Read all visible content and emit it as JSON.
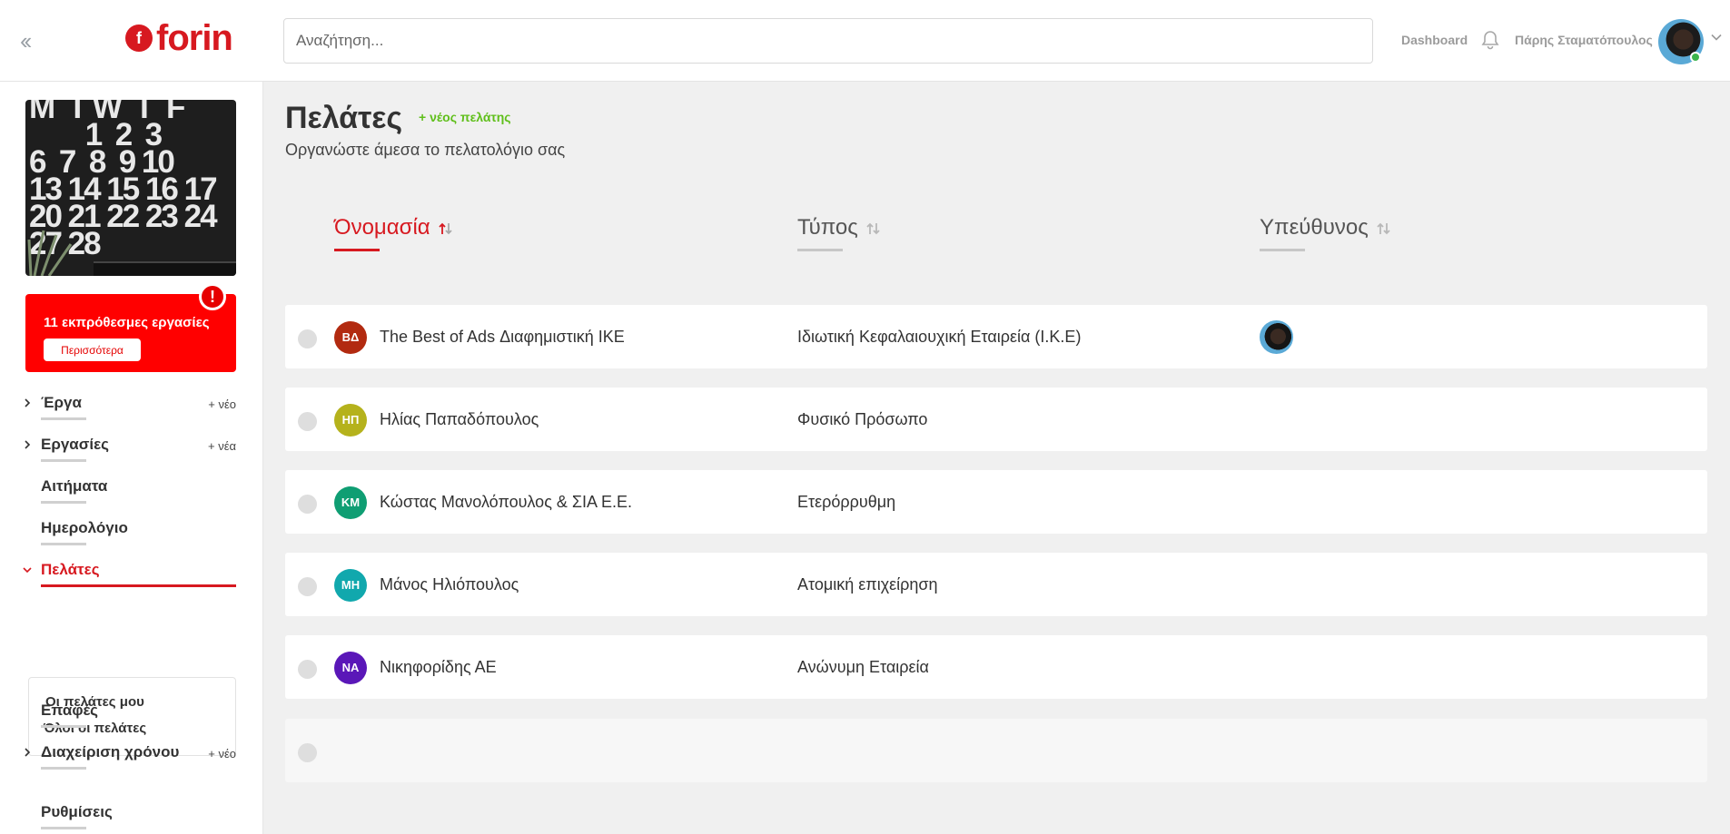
{
  "header": {
    "collapse_icon": "double-chevron-left-icon",
    "logo_text": "forin",
    "logo_mark": "f",
    "search_placeholder": "Αναζήτηση...",
    "dashboard_label": "Dashboard",
    "bell_icon": "bell-icon",
    "user_name": "Πάρης Σταματόπουλος"
  },
  "sidebar": {
    "calendar_text": "M  T W  T  F\n        1  2  3\n6  7  8  9 10\n13 14 15 16 17\n20 21 22 23 24\n27 28",
    "alert": {
      "text": "11 εκπρόθεσμες εργασίες",
      "button": "Περισσότερα",
      "badge": "!"
    },
    "items": [
      {
        "label": "Έργα",
        "add": "+ νέο",
        "chevron": "right"
      },
      {
        "label": "Εργασίες",
        "add": "+ νέα",
        "chevron": "right"
      },
      {
        "label": "Αιτήματα"
      },
      {
        "label": "Ημερολόγιο"
      },
      {
        "label": "Πελάτες",
        "chevron": "down",
        "active": true
      },
      {
        "label": "Επαφές"
      },
      {
        "label": "Διαχείριση χρόνου",
        "add": "+ νέο",
        "chevron": "right"
      },
      {
        "label": "Ρυθμίσεις"
      }
    ],
    "submenu": [
      "Οι πελάτες μου",
      "Όλοι οι πελάτες"
    ]
  },
  "main": {
    "title": "Πελάτες",
    "new_client": "+ νέος πελάτης",
    "subtitle": "Οργανώστε άμεσα το πελατολόγιο σας",
    "columns": [
      {
        "label": "Όνομασία",
        "sort": "asc"
      },
      {
        "label": "Τύπος",
        "sort": "none"
      },
      {
        "label": "Υπεύθυνος",
        "sort": "none"
      }
    ],
    "rows": [
      {
        "initials": "ΒΔ",
        "color": "#b22a10",
        "name": "The Best of Ads Διαφημιστική ΙΚΕ",
        "type": "Ιδιωτική Κεφαλαιουχική Εταιρεία (Ι.Κ.Ε)",
        "has_owner": true
      },
      {
        "initials": "ΗΠ",
        "color": "#b5b21c",
        "name": "Ηλίας Παπαδόπουλος",
        "type": "Φυσικό Πρόσωπο",
        "has_owner": false
      },
      {
        "initials": "ΚΜ",
        "color": "#0f9e73",
        "name": "Κώστας Μανολόπουλος & ΣΙΑ Ε.Ε.",
        "type": "Ετερόρρυθμη",
        "has_owner": false
      },
      {
        "initials": "ΜΗ",
        "color": "#11a8ad",
        "name": "Μάνος Ηλιόπουλος",
        "type": "Ατομική επιχείρηση",
        "has_owner": false
      },
      {
        "initials": "ΝΑ",
        "color": "#5a17b8",
        "name": "Νικηφορίδης ΑΕ",
        "type": "Ανώνυμη Εταιρεία",
        "has_owner": false
      }
    ]
  }
}
